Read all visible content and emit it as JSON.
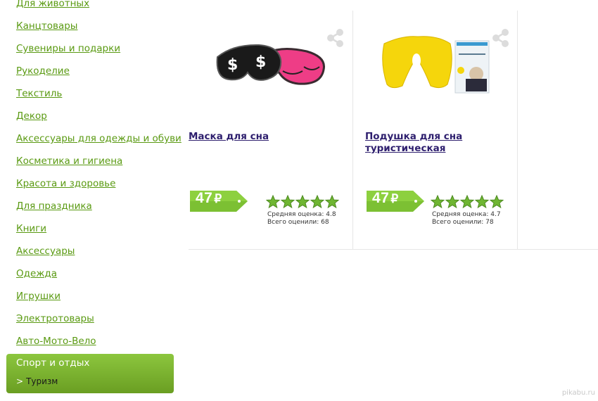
{
  "sidebar": {
    "categories": [
      {
        "label": "Для животных"
      },
      {
        "label": "Канцтовары"
      },
      {
        "label": "Сувениры и подарки"
      },
      {
        "label": "Рукоделие"
      },
      {
        "label": "Текстиль"
      },
      {
        "label": "Декор"
      },
      {
        "label": "Аксессуары для одежды и обуви"
      },
      {
        "label": "Косметика и гигиена"
      },
      {
        "label": "Красота и здоровье"
      },
      {
        "label": "Для праздника"
      },
      {
        "label": "Книги"
      },
      {
        "label": "Аксессуары"
      },
      {
        "label": "Одежда"
      },
      {
        "label": "Игрушки"
      },
      {
        "label": "Электротовары"
      },
      {
        "label": "Авто-Мото-Вело"
      }
    ],
    "active": {
      "label": "Спорт и отдых",
      "sub_prefix": ">",
      "sub_label": "Туризм"
    }
  },
  "products": [
    {
      "title": "Маска для сна",
      "price": "47",
      "currency": "₽",
      "rating_value": 5,
      "rating_max": 5,
      "avg_label": "Средняя оценка: 4.8",
      "count_label": "Всего оценили: 68",
      "image_icon": "sleep-mask-image",
      "share_icon": "share-icon"
    },
    {
      "title": "Подушка для сна туристическая",
      "price": "47",
      "currency": "₽",
      "rating_value": 5,
      "rating_max": 5,
      "avg_label": "Средняя оценка: 4.7",
      "count_label": "Всего оценили: 78",
      "image_icon": "travel-pillow-image",
      "share_icon": "share-icon"
    }
  ],
  "watermark": "pikabu.ru",
  "colors": {
    "link_green": "#5a9a12",
    "active_green": "#7cb830",
    "title_purple": "#2e1f6e",
    "price_green": "#7cc033",
    "grid_line": "#e6e6e6"
  }
}
